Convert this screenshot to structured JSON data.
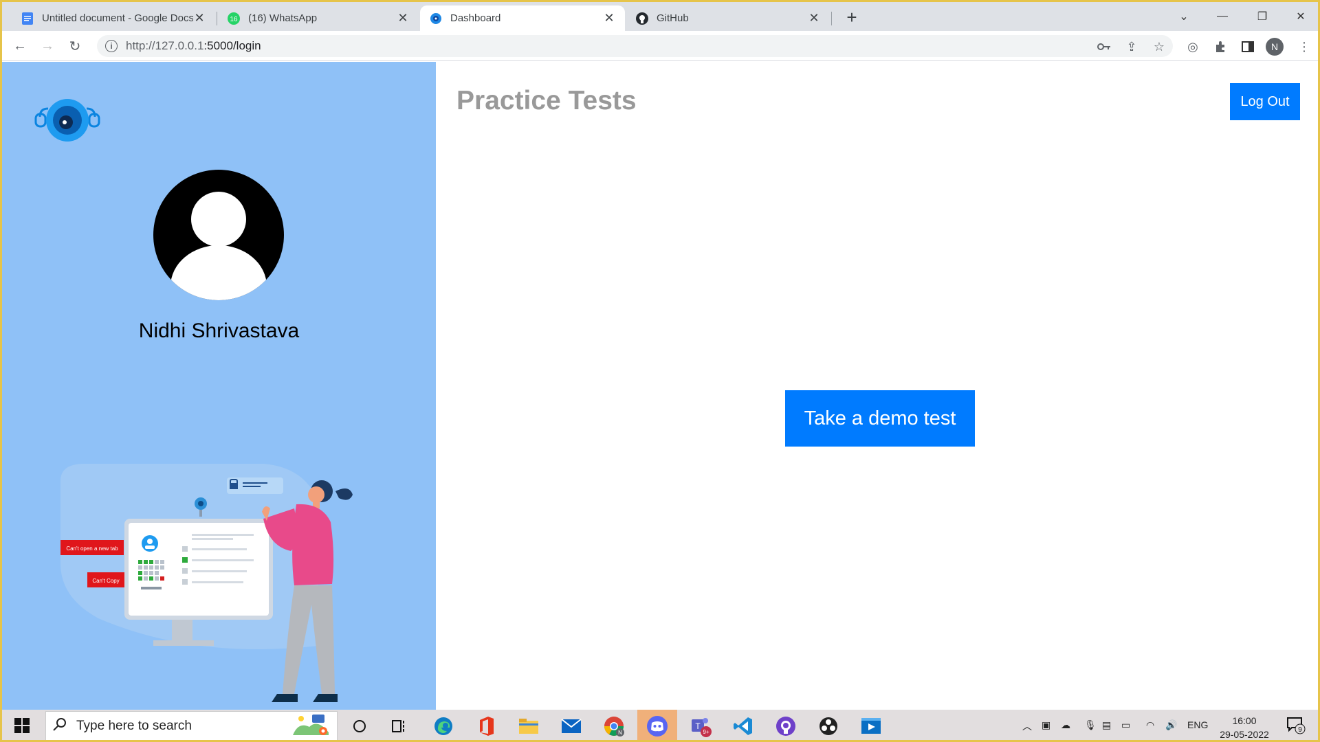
{
  "browser": {
    "tabs": [
      {
        "title": "Untitled document - Google Docs",
        "active": false
      },
      {
        "title": "(16) WhatsApp",
        "active": false,
        "badge": "16"
      },
      {
        "title": "Dashboard",
        "active": true
      },
      {
        "title": "GitHub",
        "active": false
      }
    ],
    "url_host": "http://127.0.0.1",
    "url_rest": ":5000/login",
    "profile_initial": "N"
  },
  "sidebar": {
    "user_name": "Nidhi Shrivastava",
    "illustration_labels": {
      "tab_warning": "Can't open a new tab",
      "copy_warning": "Can't Copy"
    }
  },
  "main": {
    "title": "Practice Tests",
    "logout_label": "Log Out",
    "demo_test_label": "Take a demo test"
  },
  "taskbar": {
    "search_placeholder": "Type here to search",
    "language": "ENG",
    "time": "16:00",
    "date": "29-05-2022",
    "teams_badge": "9+",
    "notification_count": "9"
  },
  "colors": {
    "sidebar_bg": "#8fc1f7",
    "primary_button": "#007bff",
    "heading": "#999999"
  }
}
